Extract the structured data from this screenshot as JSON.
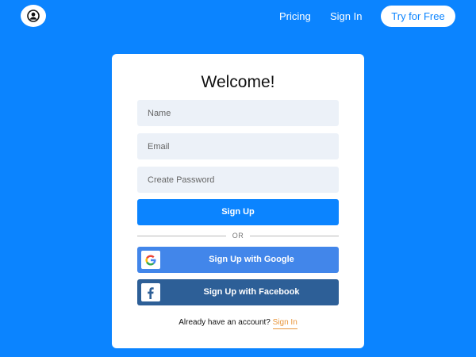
{
  "nav": {
    "pricing": "Pricing",
    "sign_in": "Sign In",
    "try_button": "Try for Free",
    "logo_icon": "user-circle-icon"
  },
  "card": {
    "title": "Welcome!",
    "fields": {
      "name_placeholder": "Name",
      "email_placeholder": "Email",
      "password_placeholder": "Create Password"
    },
    "signup_button": "Sign Up",
    "divider": "OR",
    "google_button": "Sign Up with Google",
    "google_icon": "google-icon",
    "facebook_button": "Sign Up with Facebook",
    "facebook_icon": "facebook-icon",
    "account_prompt": "Already have an account?",
    "sign_in_link": "Sign In"
  },
  "colors": {
    "background": "#0b84ff",
    "primary_button": "#0b84ff",
    "google_button": "#4286ea",
    "facebook_button": "#2d5f97",
    "link_accent": "#e8953a",
    "input_background": "#ecf1f8"
  }
}
